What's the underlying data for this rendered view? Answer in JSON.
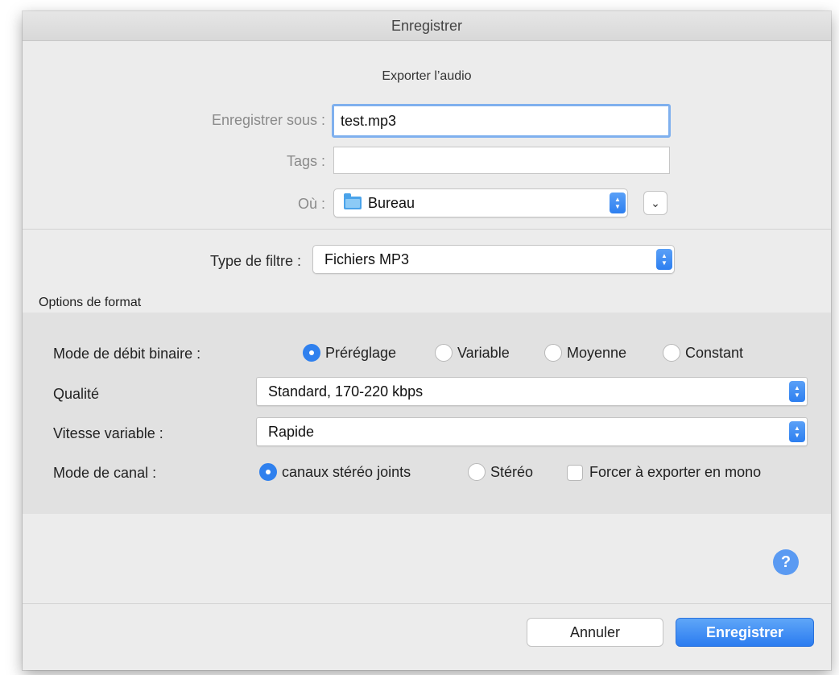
{
  "window": {
    "title": "Enregistrer"
  },
  "dialog": {
    "subtitle": "Exporter l’audio"
  },
  "save_as": {
    "label": "Enregistrer sous :",
    "value": "test.mp3"
  },
  "tags": {
    "label": "Tags :",
    "value": ""
  },
  "where": {
    "label": "Où :",
    "value": "Bureau",
    "icon": "folder-icon"
  },
  "filter": {
    "label": "Type de filtre :",
    "value": "Fichiers MP3"
  },
  "format_options": {
    "title": "Options de format",
    "bitrate_mode": {
      "label": "Mode de débit binaire :",
      "options": [
        "Préréglage",
        "Variable",
        "Moyenne",
        "Constant"
      ],
      "selected": "Préréglage"
    },
    "quality": {
      "label": "Qualité",
      "value": "Standard, 170-220 kbps"
    },
    "variable_speed": {
      "label": "Vitesse variable :",
      "value": "Rapide"
    },
    "channel_mode": {
      "label": "Mode de canal :",
      "options": [
        "canaux stéréo joints",
        "Stéréo"
      ],
      "selected": "canaux stéréo joints",
      "mono_checkbox": {
        "label": "Forcer à exporter en mono",
        "checked": false
      }
    }
  },
  "help_button": {
    "glyph": "?"
  },
  "buttons": {
    "cancel": "Annuler",
    "save": "Enregistrer"
  },
  "colors": {
    "accent": "#2f80ee",
    "window_bg": "#ececec",
    "group_bg": "#e1e1e1"
  }
}
